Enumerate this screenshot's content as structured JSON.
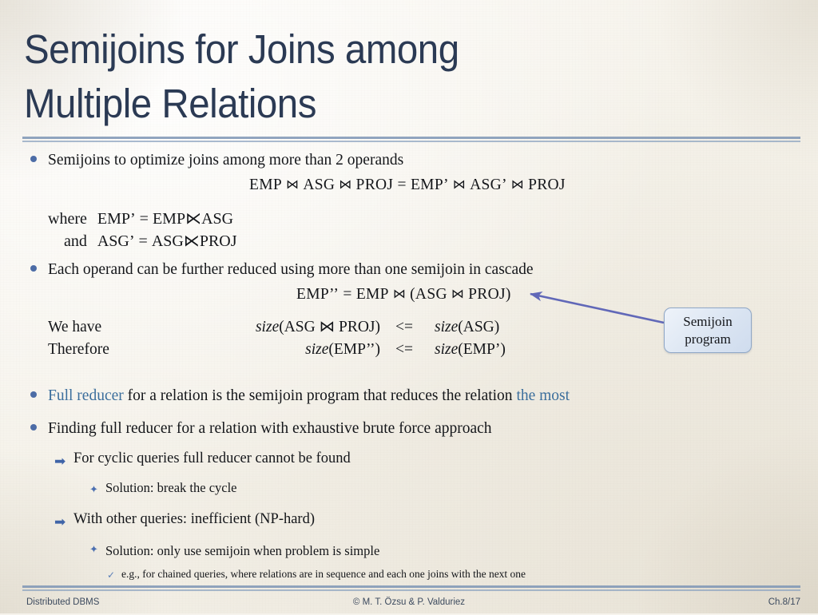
{
  "slide": {
    "title": "Semijoins for Joins among\nMultiple Relations",
    "accent_color": "#3b6e9c",
    "title_color": "#2b3a54",
    "rule_color": "#7e95b5"
  },
  "content": {
    "bullet1": "Semijoins to optimize joins among more than 2 operands",
    "formula1": {
      "left": "EMP",
      "op1": "⋈",
      "mid1": "ASG",
      "op2": "⋈",
      "mid2": "PROJ",
      "eq": "=",
      "right1": "EMP’",
      "op3": "⋈",
      "right2": "ASG’",
      "op4": "⋈",
      "right3": "PROJ"
    },
    "where_rows": [
      {
        "label": "where",
        "expr_left": "EMP’",
        "eq": "=",
        "a": "EMP",
        "op": "⋉",
        "b": "ASG"
      },
      {
        "label": "and",
        "expr_left": "ASG’",
        "eq": "=",
        "a": "ASG",
        "op": "⋉",
        "b": "PROJ"
      }
    ],
    "bullet2": "Each operand can be further reduced using more than one semijoin in cascade",
    "formula2": {
      "lhs": "EMP’’",
      "eq": "=",
      "a": "EMP",
      "op1": "⋈",
      "open": "(ASG",
      "op2": "⋈",
      "close": "PROJ)"
    },
    "size_rows": [
      {
        "label": "We have",
        "expr": "size(ASG ⋈ PROJ)",
        "expr_fn": "size",
        "expr_arg": "(ASG ⋈ PROJ)",
        "rel": "<=",
        "right_fn": "size",
        "right_arg": "(ASG)"
      },
      {
        "label": "Therefore",
        "expr": "size(EMP’’)",
        "expr_fn": "size",
        "expr_arg": "(EMP’’)",
        "rel": "<=",
        "right_fn": "size",
        "right_arg": "(EMP’)"
      }
    ],
    "bullet3": {
      "part_accent_1": "Full reducer",
      "part_plain": " for a relation is the semijoin program that reduces the relation ",
      "part_accent_2": "the most"
    },
    "bullet4": "Finding full reducer for a relation with exhaustive brute force approach",
    "sub1": "For cyclic queries full reducer cannot be found",
    "sub1_child": "Solution: break the cycle",
    "sub2": "With other queries: inefficient (NP-hard)",
    "sub2_child": "Solution: only use semijoin when problem is simple",
    "sub2_grandchild": "e.g., for chained queries, where relations are in sequence and each one joins with the next one",
    "callout": "Semijoin\nprogram",
    "markers": {
      "bullet_dot": "bullet-dot",
      "arrow": "➡",
      "star": "✦",
      "check": "✓"
    }
  },
  "footer": {
    "left": "Distributed DBMS",
    "center": "© M. T. Özsu & P. Valduriez",
    "right": "Ch.8/17"
  }
}
